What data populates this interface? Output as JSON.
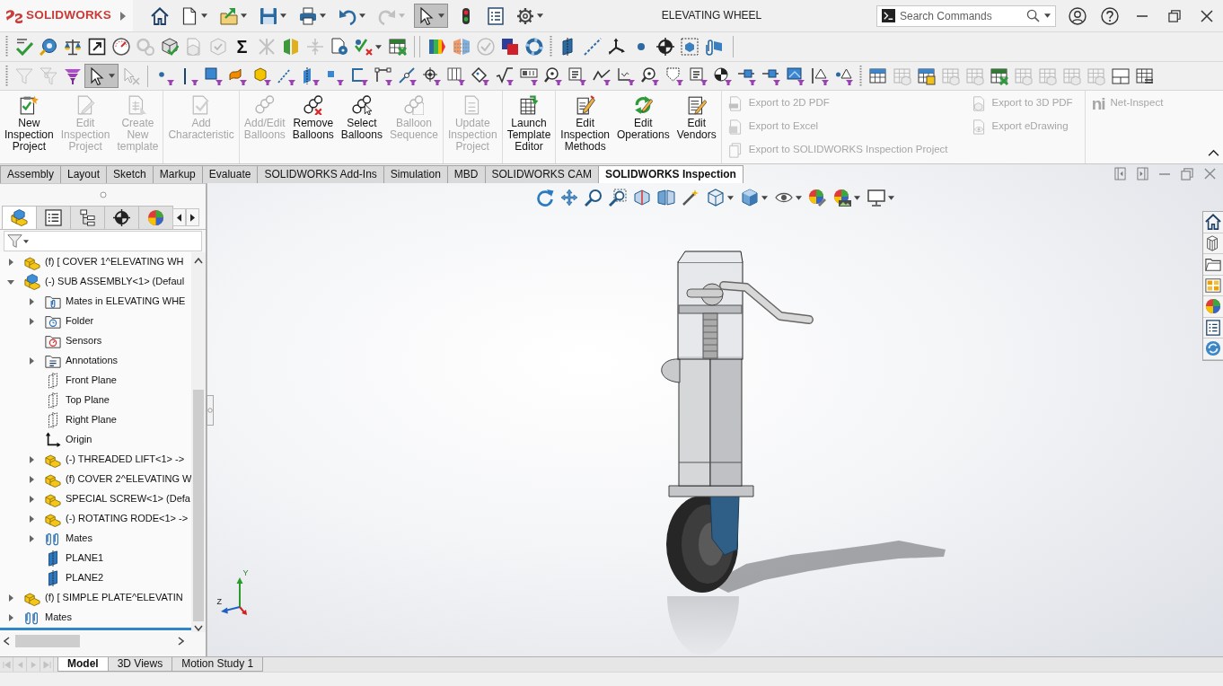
{
  "title_bar": {
    "logo": "SOLIDWORKS",
    "title": "ELEVATING WHEEL",
    "search": {
      "placeholder": "Search Commands"
    }
  },
  "standard_toolbar": [
    {
      "disabled": false,
      "pressed": false
    },
    {
      "disabled": false,
      "pressed": false
    },
    {
      "disabled": false,
      "pressed": false
    },
    {
      "disabled": false,
      "pressed": false
    },
    {
      "disabled": false,
      "pressed": false
    },
    {
      "disabled": false,
      "pressed": false
    },
    {
      "disabled": true,
      "pressed": false
    },
    {
      "disabled": false,
      "pressed": true
    },
    {
      "disabled": false,
      "pressed": false
    },
    {
      "disabled": false,
      "pressed": false
    },
    {
      "disabled": false,
      "pressed": false
    }
  ],
  "command_toolbar": [
    [
      {
        "disabled": false
      },
      {
        "disabled": false
      },
      {
        "disabled": false
      },
      {
        "disabled": false
      },
      {
        "disabled": false
      },
      {
        "disabled": true
      },
      {
        "disabled": false
      },
      {
        "disabled": true
      },
      {
        "disabled": true
      },
      {
        "disabled": false,
        "glyph": "Σ"
      },
      {
        "disabled": true
      },
      {
        "disabled": false
      },
      {
        "disabled": true
      },
      {
        "disabled": false
      },
      {
        "disabled": false
      },
      {
        "disabled": false
      }
    ],
    [
      {
        "disabled": false
      },
      {
        "disabled": false
      },
      {
        "disabled": true
      },
      {
        "disabled": false
      },
      {
        "disabled": false
      }
    ],
    [
      {
        "disabled": false
      },
      {
        "disabled": false
      },
      {
        "disabled": false
      },
      {
        "disabled": false
      },
      {
        "disabled": false
      },
      {
        "disabled": false
      },
      {
        "disabled": false
      }
    ]
  ],
  "selection_toolbar": [
    [
      {
        "disabled": true,
        "pressed": false
      },
      {
        "disabled": true,
        "pressed": false
      },
      {
        "disabled": false,
        "pressed": false
      },
      {
        "disabled": false,
        "pressed": true
      },
      {
        "disabled": true,
        "pressed": false
      }
    ],
    [
      {
        "disabled": false
      },
      {
        "disabled": false
      },
      {
        "disabled": false
      },
      {
        "disabled": false
      },
      {
        "disabled": false
      },
      {
        "disabled": false
      },
      {
        "disabled": false
      },
      {
        "disabled": false
      },
      {
        "disabled": false
      },
      {
        "disabled": false
      },
      {
        "disabled": false
      },
      {
        "disabled": false
      },
      {
        "disabled": false
      },
      {
        "disabled": false
      },
      {
        "disabled": false
      },
      {
        "disabled": false
      },
      {
        "disabled": false
      },
      {
        "disabled": false
      },
      {
        "disabled": false
      },
      {
        "disabled": false
      },
      {
        "disabled": false
      },
      {
        "disabled": false
      },
      {
        "disabled": false
      },
      {
        "disabled": false
      },
      {
        "disabled": false
      },
      {
        "disabled": false
      },
      {
        "disabled": false
      },
      {
        "disabled": false
      },
      {
        "disabled": false
      }
    ],
    [
      {
        "disabled": false
      },
      {
        "disabled": true
      },
      {
        "disabled": false
      },
      {
        "disabled": true
      },
      {
        "disabled": true
      },
      {
        "disabled": false
      },
      {
        "disabled": true
      },
      {
        "disabled": true
      },
      {
        "disabled": true
      },
      {
        "disabled": true
      },
      {
        "disabled": false
      },
      {
        "disabled": false
      }
    ]
  ],
  "ribbon": {
    "groups": [
      [
        {
          "label": "New Inspection Project",
          "disabled": false
        },
        {
          "label": "Edit Inspection Project",
          "disabled": true
        },
        {
          "label": "Create New template",
          "disabled": true
        }
      ],
      [
        {
          "label": "Add Characteristic",
          "disabled": true
        }
      ],
      [
        {
          "label": "Add/Edit Balloons",
          "disabled": true
        },
        {
          "label": "Remove Balloons",
          "disabled": false
        },
        {
          "label": "Select Balloons",
          "disabled": false
        },
        {
          "label": "Balloon Sequence",
          "disabled": true
        }
      ],
      [
        {
          "label": "Update Inspection Project",
          "disabled": true
        }
      ],
      [
        {
          "label": "Launch Template Editor",
          "disabled": false
        }
      ],
      [
        {
          "label": "Edit Inspection Methods",
          "disabled": false
        },
        {
          "label": "Edit Operations",
          "disabled": false
        },
        {
          "label": "Edit Vendors",
          "disabled": false
        }
      ]
    ],
    "export_columns": [
      [
        {
          "label": "Export to 2D PDF",
          "disabled": true
        },
        {
          "label": "Export to Excel",
          "disabled": true
        },
        {
          "label": "Export to SOLIDWORKS Inspection Project",
          "disabled": true
        }
      ],
      [
        {
          "label": "Export to 3D PDF",
          "disabled": true
        },
        {
          "label": "Export eDrawing",
          "disabled": true
        }
      ]
    ],
    "net_inspect": {
      "logo": "ni",
      "label": "Net-Inspect",
      "disabled": true
    }
  },
  "command_tabs": [
    {
      "label": "Assembly",
      "selected": false
    },
    {
      "label": "Layout",
      "selected": false
    },
    {
      "label": "Sketch",
      "selected": false
    },
    {
      "label": "Markup",
      "selected": false
    },
    {
      "label": "Evaluate",
      "selected": false
    },
    {
      "label": "SOLIDWORKS Add-Ins",
      "selected": false
    },
    {
      "label": "Simulation",
      "selected": false
    },
    {
      "label": "MBD",
      "selected": false
    },
    {
      "label": "SOLIDWORKS CAM",
      "selected": false
    },
    {
      "label": "SOLIDWORKS Inspection",
      "selected": true
    }
  ],
  "feature_manager": {
    "tabs": [
      {
        "selected": true
      },
      {
        "selected": false
      },
      {
        "selected": false
      },
      {
        "selected": false
      },
      {
        "selected": false
      }
    ],
    "tree": [
      {
        "label": "(f) [ COVER 1^ELEVATING WH",
        "kind": "part",
        "expanded": false
      },
      {
        "label": "(-) SUB ASSEMBLY<1> (Defaul",
        "kind": "assembly",
        "expanded": true,
        "children": [
          {
            "label": "Mates in ELEVATING WHE",
            "kind": "mates-folder",
            "expanded": false
          },
          {
            "label": "Folder",
            "kind": "folder",
            "expanded": false
          },
          {
            "label": "Sensors",
            "kind": "sensors"
          },
          {
            "label": "Annotations",
            "kind": "annotations",
            "expanded": false
          },
          {
            "label": "Front Plane",
            "kind": "plane"
          },
          {
            "label": "Top Plane",
            "kind": "plane"
          },
          {
            "label": "Right Plane",
            "kind": "plane"
          },
          {
            "label": "Origin",
            "kind": "origin"
          },
          {
            "label": "(-) THREADED LIFT<1> ->",
            "kind": "part",
            "expanded": false
          },
          {
            "label": "(f) COVER 2^ELEVATING W",
            "kind": "part",
            "expanded": false
          },
          {
            "label": "SPECIAL SCREW<1> (Defa",
            "kind": "part",
            "expanded": false
          },
          {
            "label": "(-) ROTATING RODE<1> ->",
            "kind": "part",
            "expanded": false
          },
          {
            "label": "Mates",
            "kind": "mates",
            "expanded": false
          },
          {
            "label": "PLANE1",
            "kind": "ref-plane"
          },
          {
            "label": "PLANE2",
            "kind": "ref-plane"
          }
        ]
      },
      {
        "label": "(f) [ SIMPLE PLATE^ELEVATIN",
        "kind": "part",
        "expanded": false
      },
      {
        "label": "Mates",
        "kind": "mates",
        "expanded": false
      }
    ]
  },
  "axis_triad": {
    "labels": [
      "Y",
      "Z"
    ]
  },
  "tab_scroll_buttons": [
    {
      "disabled": true
    },
    {
      "disabled": true
    },
    {
      "disabled": true
    },
    {
      "disabled": true
    }
  ],
  "model_tabs": [
    {
      "label": "Model",
      "selected": true
    },
    {
      "label": "3D Views",
      "selected": false
    },
    {
      "label": "Motion Study 1",
      "selected": false
    }
  ]
}
